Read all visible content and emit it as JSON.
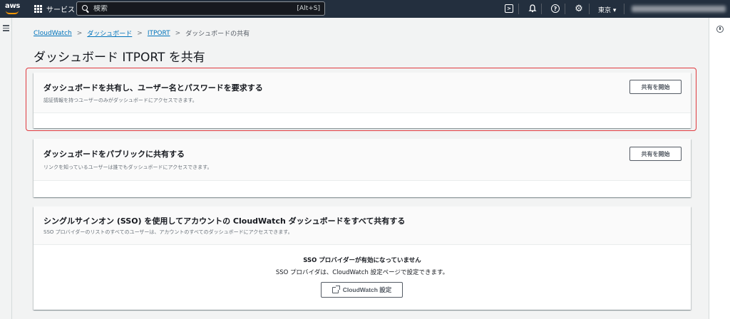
{
  "topnav": {
    "logo": "aws",
    "services_label": "サービス",
    "search_placeholder": "検索",
    "search_shortcut": "[Alt+S]",
    "region_label": "東京 ▾",
    "icons": [
      "terminal-icon",
      "bell-icon",
      "help-icon",
      "gear-icon"
    ],
    "colors": {
      "bar": "#232f3e",
      "accent": "#ff9900"
    }
  },
  "breadcrumb": {
    "items": [
      "CloudWatch",
      "ダッシュボード",
      "ITPORT"
    ],
    "current": "ダッシュボードの共有",
    "separator": ">"
  },
  "page": {
    "title": "ダッシュボード ITPORT を共有"
  },
  "cards": [
    {
      "title": "ダッシュボードを共有し、ユーザー名とパスワードを要求する",
      "description": "認証情報を持つユーザーのみがダッシュボードにアクセスできます。",
      "button": "共有を開始"
    },
    {
      "title": "ダッシュボードをパブリックに共有する",
      "description": "リンクを知っているユーザーは誰でもダッシュボードにアクセスできます。",
      "button": "共有を開始"
    },
    {
      "title": "シングルサインオン (SSO) を使用してアカウントの CloudWatch ダッシュボードをすべて共有する",
      "description": "SSO プロバイダーのリストのすべてのユーザーは、アカウントのすべてのダッシュボードにアクセスできます。",
      "body_title": "SSO プロバイダーが有効になっていません",
      "body_desc": "SSO プロバイダは、CloudWatch 設定ページで設定できます。",
      "button": "CloudWatch 設定"
    }
  ],
  "highlight_color": "#e0393e"
}
